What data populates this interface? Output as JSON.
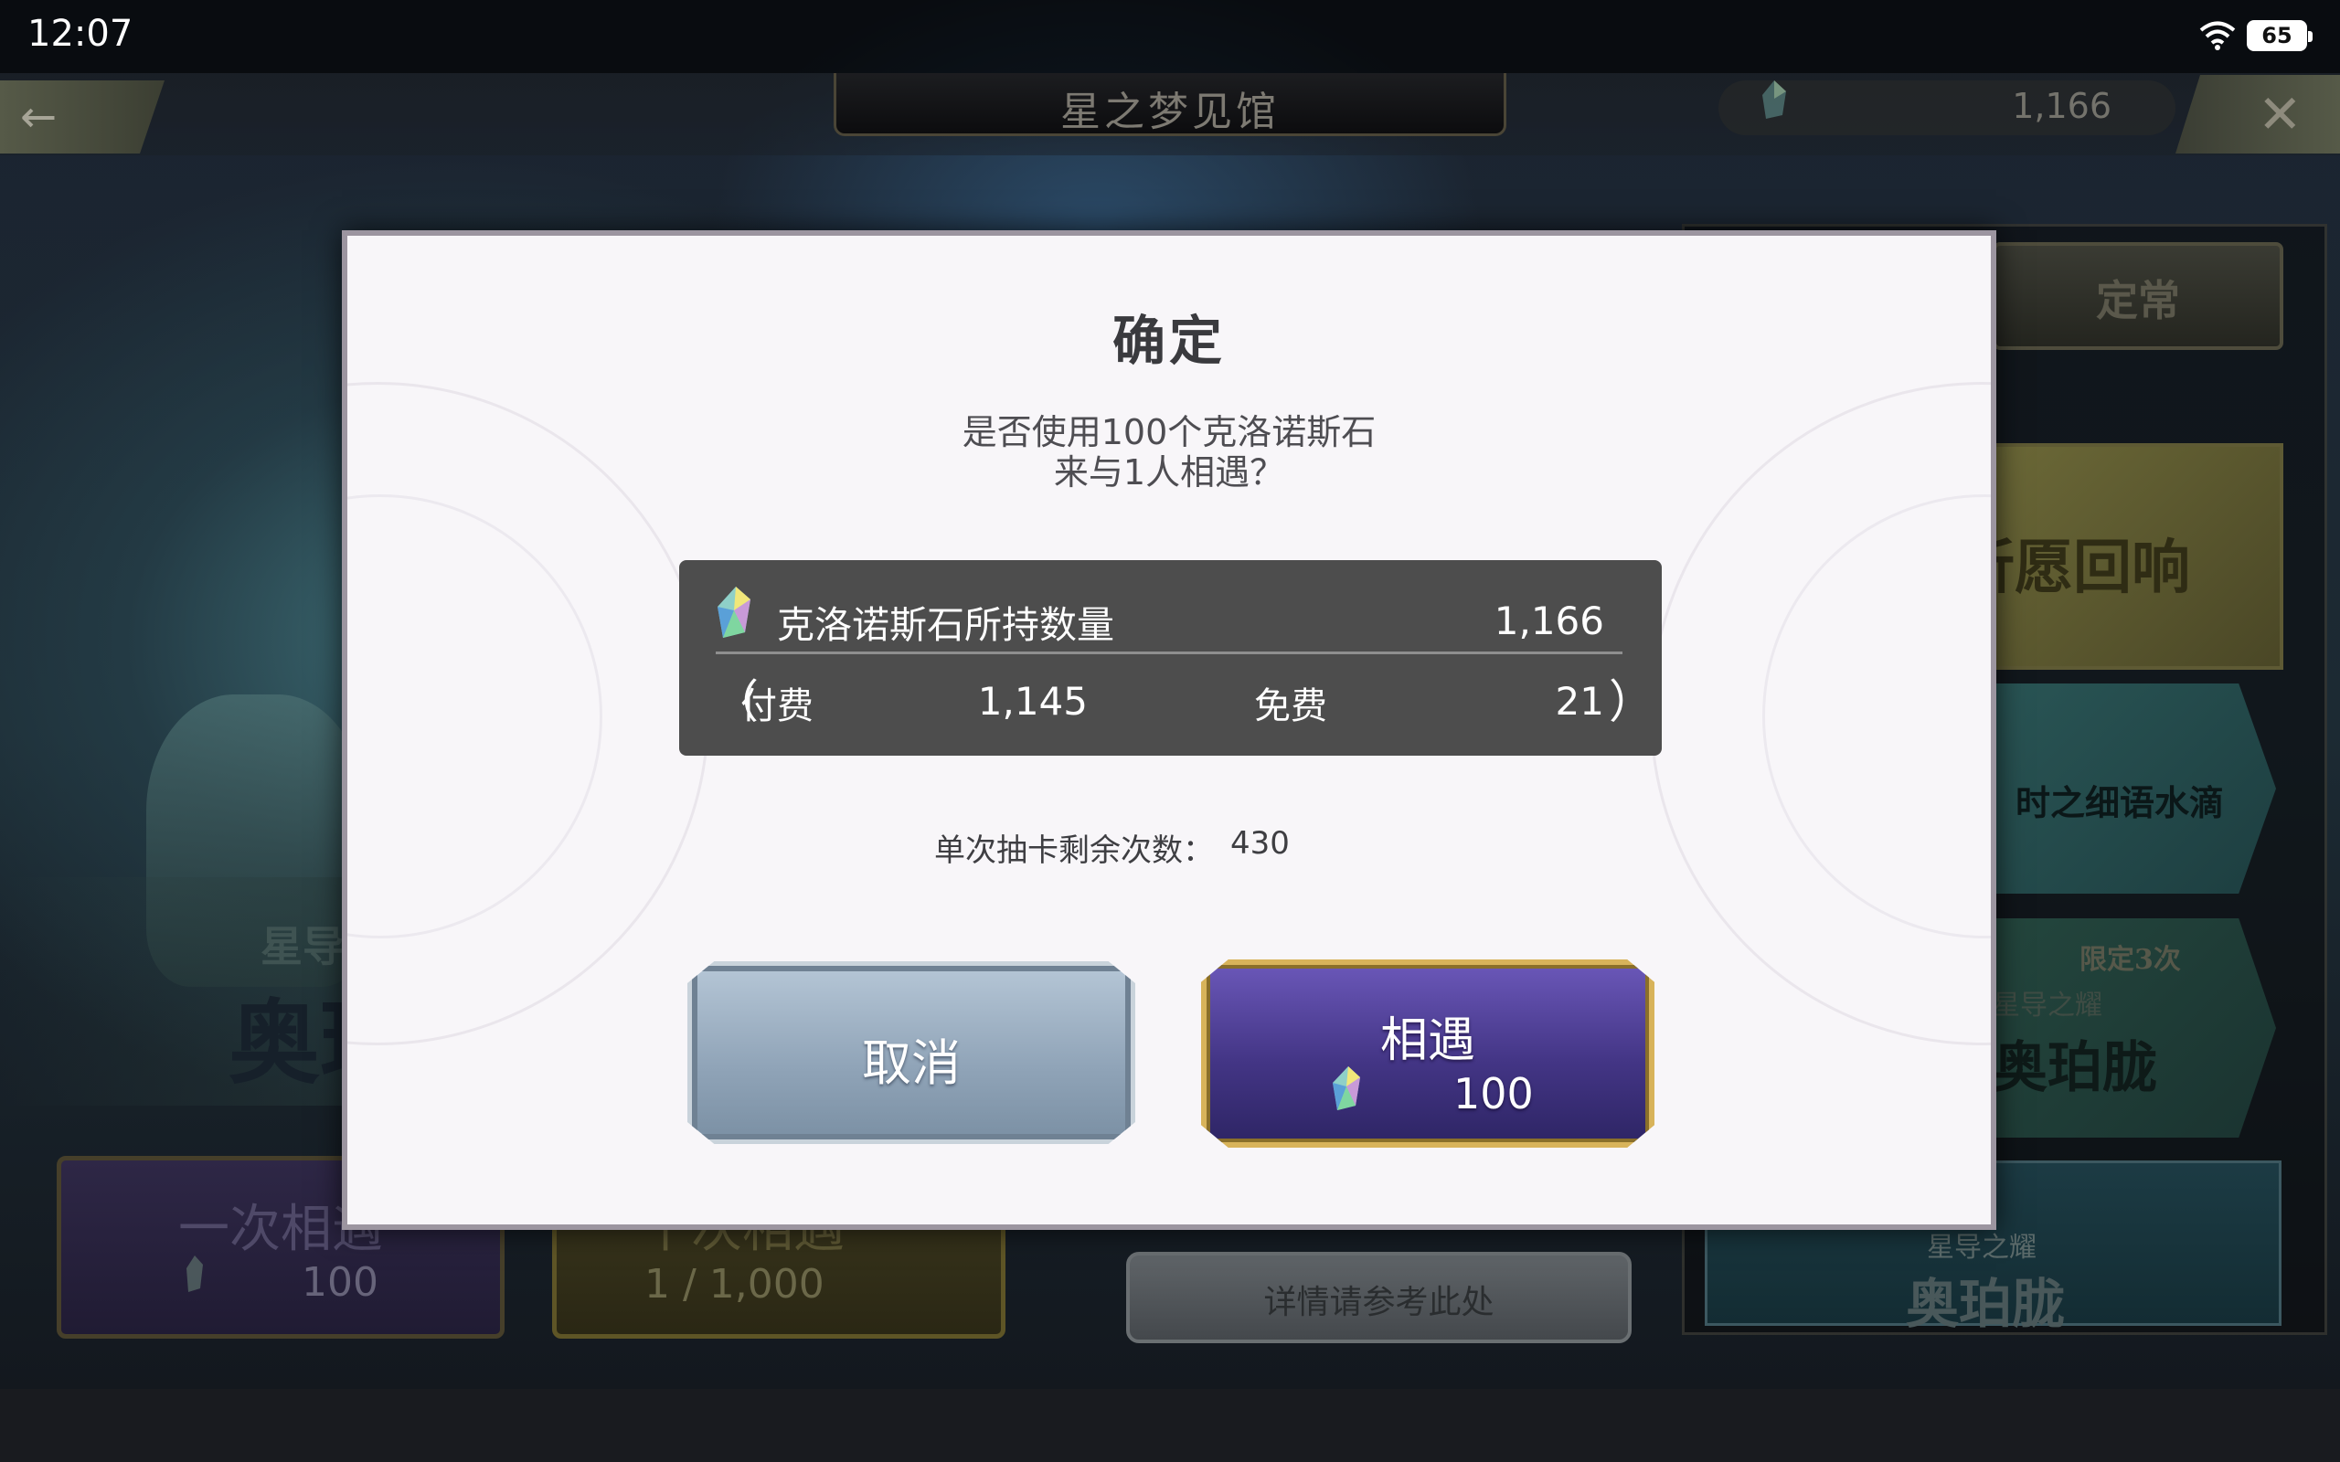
{
  "status_bar": {
    "time": "12:07",
    "battery": "65"
  },
  "header": {
    "title": "星之梦见馆",
    "currency_value": "1,166"
  },
  "side_tabs": {
    "regular": "定常",
    "banner_1": "祈愿回响",
    "banner_2": "时之细语水滴",
    "banner_3_tag": "限定3次",
    "banner_3_sub": "星导之耀",
    "banner_3_name": "奥珀胧",
    "banner_4_sub": "星导之耀",
    "banner_4_name": "奥珀胧"
  },
  "featured": {
    "sub": "星导",
    "name": "奥珀"
  },
  "pull_buttons": {
    "once_label": "一次相遇",
    "once_cost": "100",
    "ten_label": "十次相遇",
    "ten_cost": "1 / 1,000"
  },
  "details_button": "详情请参考此处",
  "dialog": {
    "title": "确定",
    "message_line1": "是否使用100个克洛诺斯石",
    "message_line2": "来与1人相遇？",
    "stone_label": "克洛诺斯石所持数量",
    "stone_total": "1,166",
    "paren_open": "（",
    "paren_close": "）",
    "paid_label": "付费",
    "paid_value": "1,145",
    "free_label": "免费",
    "free_value": "21",
    "remaining_label": "单次抽卡剩余次数：",
    "remaining_value": "430",
    "cancel_label": "取消",
    "confirm_label": "相遇",
    "confirm_cost": "100"
  },
  "colors": {
    "dialog_bg": "#f8f6f9",
    "stone_box_bg": "#4d4d4d",
    "confirm_gold_border": "#d8b35a",
    "confirm_purple": "#433585",
    "cancel_blue": "#8fa3b7"
  },
  "icons": [
    "wifi-icon",
    "battery-icon",
    "back-arrow-icon",
    "close-x-icon",
    "chronos-stone-gem-icon"
  ]
}
